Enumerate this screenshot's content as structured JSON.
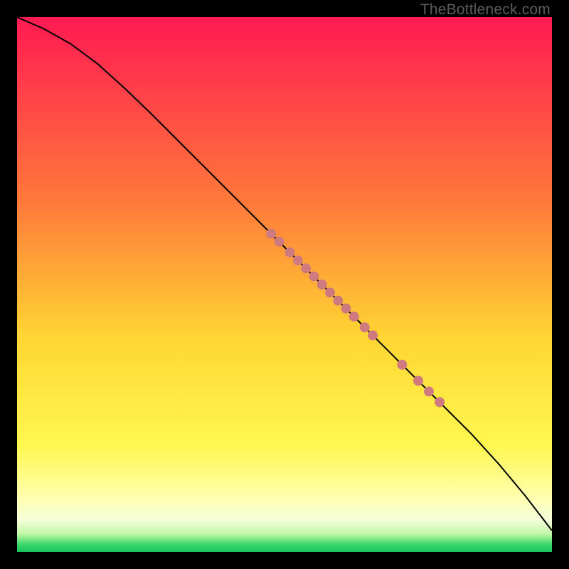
{
  "watermark": "TheBottleneck.com",
  "chart_data": {
    "type": "line",
    "title": "",
    "xlabel": "",
    "ylabel": "",
    "xlim": [
      0,
      100
    ],
    "ylim": [
      0,
      100
    ],
    "background_gradient": [
      {
        "stop": 0.0,
        "color": "#ff1a52"
      },
      {
        "stop": 0.35,
        "color": "#ff7a3a"
      },
      {
        "stop": 0.6,
        "color": "#ffd633"
      },
      {
        "stop": 0.8,
        "color": "#fff74f"
      },
      {
        "stop": 0.9,
        "color": "#ffffb0"
      },
      {
        "stop": 0.94,
        "color": "#f5ffda"
      },
      {
        "stop": 0.965,
        "color": "#c6f9ab"
      },
      {
        "stop": 0.975,
        "color": "#86eb88"
      },
      {
        "stop": 0.985,
        "color": "#3fd86e"
      },
      {
        "stop": 1.0,
        "color": "#14c45d"
      }
    ],
    "series": [
      {
        "name": "curve",
        "type": "line",
        "points": [
          {
            "x": 0,
            "y": 100.0
          },
          {
            "x": 5,
            "y": 97.8
          },
          {
            "x": 10,
            "y": 95.0
          },
          {
            "x": 15,
            "y": 91.3
          },
          {
            "x": 20,
            "y": 86.8
          },
          {
            "x": 25,
            "y": 82.0
          },
          {
            "x": 30,
            "y": 77.0
          },
          {
            "x": 35,
            "y": 72.0
          },
          {
            "x": 40,
            "y": 67.0
          },
          {
            "x": 45,
            "y": 62.0
          },
          {
            "x": 50,
            "y": 57.0
          },
          {
            "x": 55,
            "y": 52.0
          },
          {
            "x": 60,
            "y": 47.0
          },
          {
            "x": 65,
            "y": 42.0
          },
          {
            "x": 70,
            "y": 37.0
          },
          {
            "x": 75,
            "y": 32.0
          },
          {
            "x": 80,
            "y": 27.0
          },
          {
            "x": 85,
            "y": 22.0
          },
          {
            "x": 90,
            "y": 16.5
          },
          {
            "x": 95,
            "y": 10.5
          },
          {
            "x": 100,
            "y": 4.0
          }
        ]
      },
      {
        "name": "highlighted-points",
        "type": "scatter",
        "color": "#cf7a7e",
        "points": [
          {
            "x": 47.5,
            "y": 59.5
          },
          {
            "x": 49.0,
            "y": 58.0
          },
          {
            "x": 51.0,
            "y": 56.0
          },
          {
            "x": 52.5,
            "y": 54.5
          },
          {
            "x": 54.0,
            "y": 53.0
          },
          {
            "x": 55.5,
            "y": 51.5
          },
          {
            "x": 57.0,
            "y": 50.0
          },
          {
            "x": 58.5,
            "y": 48.5
          },
          {
            "x": 60.0,
            "y": 47.0
          },
          {
            "x": 61.5,
            "y": 45.5
          },
          {
            "x": 63.0,
            "y": 44.0
          },
          {
            "x": 65.0,
            "y": 42.0
          },
          {
            "x": 66.5,
            "y": 40.5
          },
          {
            "x": 72.0,
            "y": 35.0
          },
          {
            "x": 75.0,
            "y": 32.0
          },
          {
            "x": 77.0,
            "y": 30.0
          },
          {
            "x": 79.0,
            "y": 28.0
          }
        ]
      }
    ]
  }
}
